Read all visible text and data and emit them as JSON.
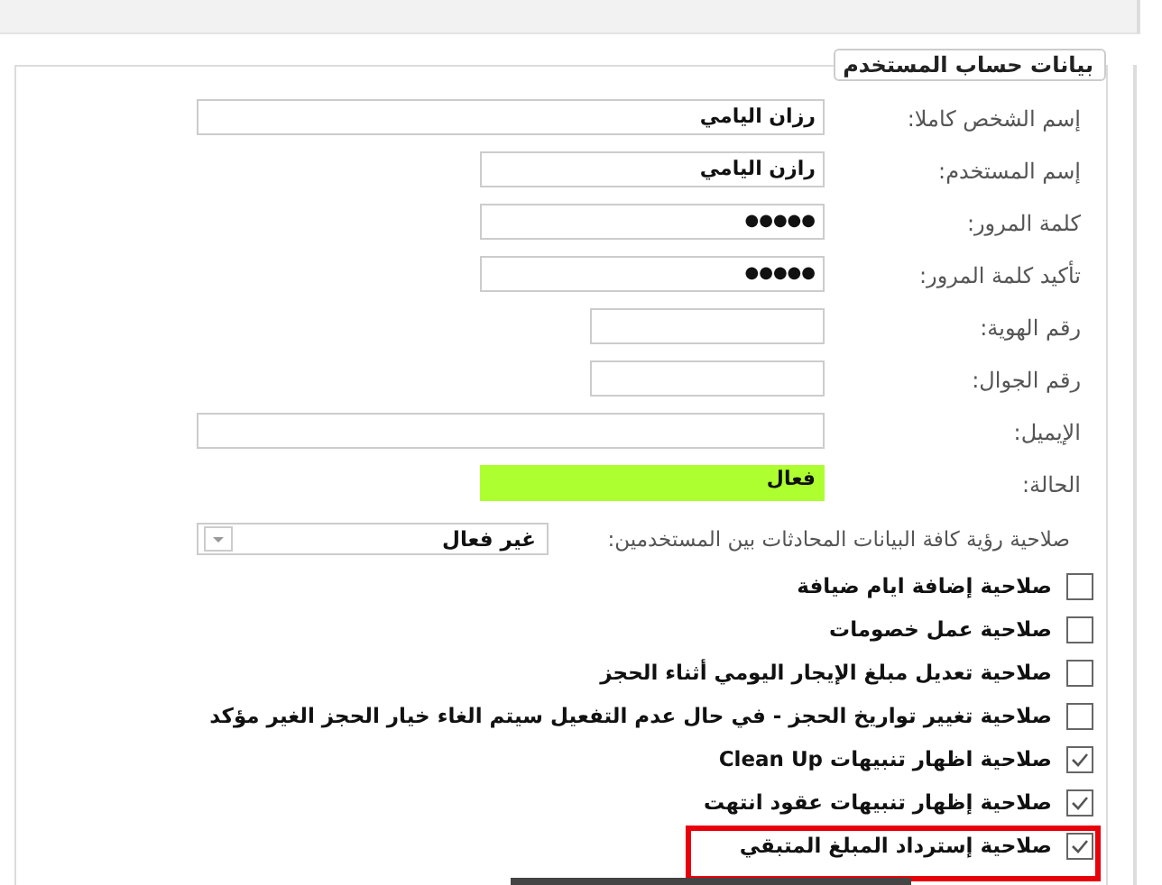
{
  "panel": {
    "title": "بيانات حساب المستخدم"
  },
  "fields": [
    {
      "label": "إسم الشخص كاملا:",
      "value": "رزان اليامي",
      "kind": "text"
    },
    {
      "label": "إسم المستخدم:",
      "value": "رازن اليامي",
      "kind": "text"
    },
    {
      "label": "كلمة المرور:",
      "value": "●●●●●",
      "kind": "password"
    },
    {
      "label": "تأكيد كلمة المرور:",
      "value": "●●●●●",
      "kind": "password"
    },
    {
      "label": "رقم الهوية:",
      "kind": "text"
    },
    {
      "label": "رقم الجوال:",
      "kind": "text"
    },
    {
      "label": "الإيميل:",
      "kind": "text"
    },
    {
      "label": "الحالة:",
      "value": "فعال",
      "kind": "status"
    }
  ],
  "dropdown": {
    "label": "صلاحية رؤية كافة البيانات المحادثات بين المستخدمين:",
    "value": "غير فعال"
  },
  "permissions": [
    {
      "label": "صلاحية إضافة ايام ضيافة",
      "checked": false,
      "highlighted": false
    },
    {
      "label": "صلاحية عمل خصومات",
      "checked": false,
      "highlighted": false
    },
    {
      "label": "صلاحية تعديل مبلغ الإيجار اليومي أثناء الحجز",
      "checked": false,
      "highlighted": false
    },
    {
      "label": "صلاحية تغيير تواريخ الحجز - في حال عدم التفعيل سيتم الغاء خيار الحجز الغير مؤكد",
      "checked": false,
      "highlighted": false
    },
    {
      "label": "صلاحية اظهار تنبيهات Clean Up",
      "checked": true,
      "highlighted": false
    },
    {
      "label": "صلاحية إظهار تنبيهات عقود انتهت",
      "checked": true,
      "highlighted": false
    },
    {
      "label": "صلاحية إسترداد المبلغ المتبقي",
      "checked": true,
      "highlighted": true
    }
  ]
}
